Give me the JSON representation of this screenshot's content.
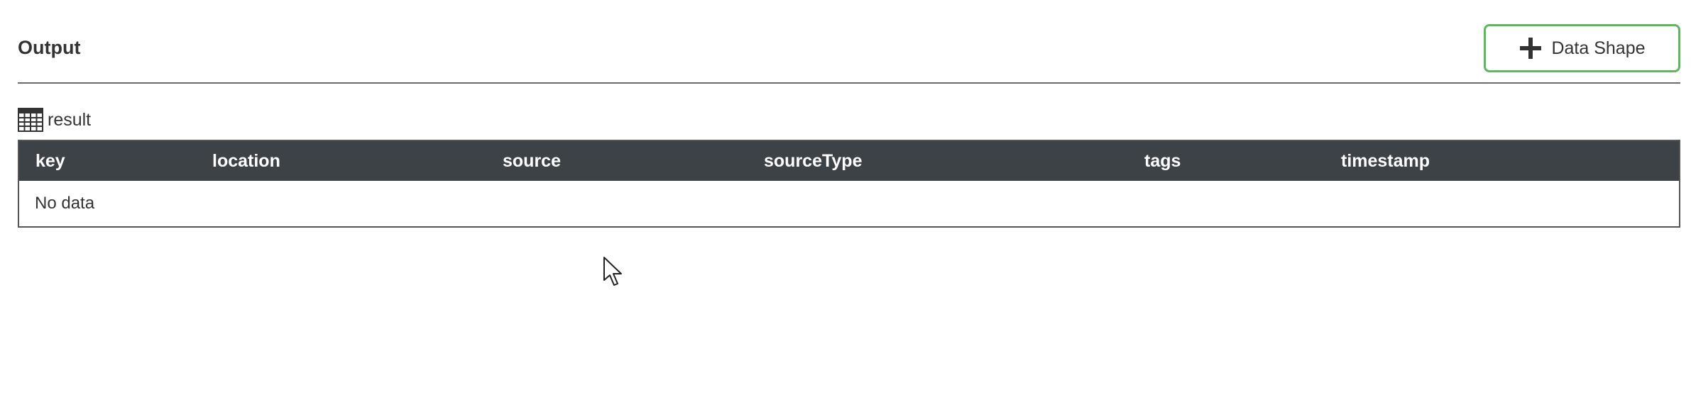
{
  "output": {
    "title": "Output",
    "add_button_label": "Data Shape"
  },
  "result": {
    "label": "result",
    "columns": [
      "key",
      "location",
      "source",
      "sourceType",
      "tags",
      "timestamp"
    ],
    "empty_message": "No data"
  },
  "icons": {
    "add": "plus-icon",
    "result": "table-icon",
    "pointer": "mouse-cursor-icon"
  },
  "colors": {
    "header_bg": "#3d4246",
    "button_border": "#5cb85c",
    "text": "#333333"
  }
}
